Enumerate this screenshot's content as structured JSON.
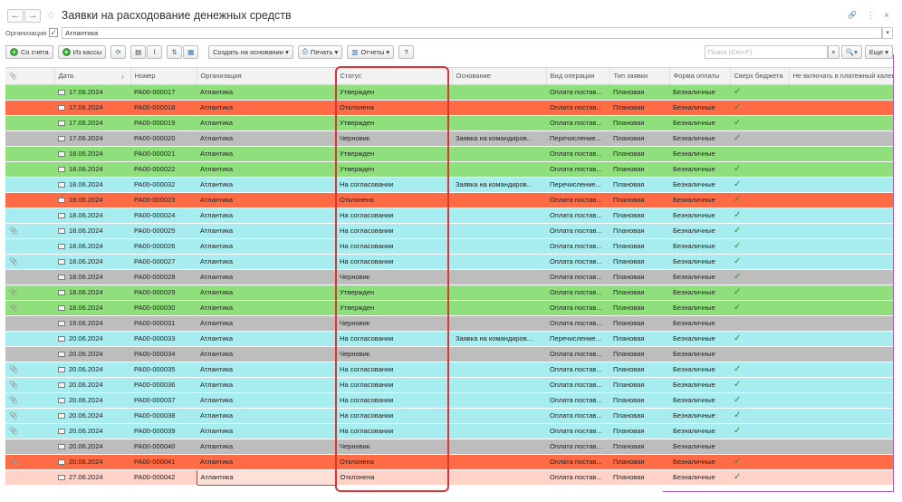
{
  "window": {
    "title": "Заявки на расходование денежных средств",
    "back_icon": "←",
    "forward_icon": "→",
    "star_icon": "☆",
    "link_icon": "🔗",
    "menu_icon": "⋮",
    "close_icon": "×"
  },
  "filter": {
    "label": "Организация",
    "checked_mark": "✓",
    "value": "Атлантика",
    "dropdown_icon": "▾"
  },
  "toolbar": {
    "from_account": "Со счета",
    "from_cash": "Из кассы",
    "create_based": "Создать на основании ▾",
    "print": "Печать ▾",
    "reports": "Отчеты ▾",
    "help": "?",
    "search_placeholder": "Поиск (Ctrl+F)",
    "search_clear": "×",
    "search_btn": "🔍▾",
    "more": "Еще ▾"
  },
  "columns": {
    "attach": "📎",
    "date": "Дата",
    "sort": "↓",
    "number": "Номер",
    "org": "Организация",
    "status": "Статус",
    "basis": "Основание",
    "op": "Вид операции",
    "type": "Тип заявки",
    "payform": "Форма оплаты",
    "over": "Сверх бюджета",
    "exclude": "Не включать в платежный календарь"
  },
  "rows": [
    {
      "c": "green",
      "clip": "",
      "date": "17.06.2024",
      "num": "РА00-000017",
      "org": "Атлантика",
      "status": "Утвержден",
      "basis": "",
      "op": "Оплата постав...",
      "type": "Плановая",
      "pay": "Безналичные",
      "over": "✓"
    },
    {
      "c": "red",
      "clip": "",
      "date": "17.06.2024",
      "num": "РА00-000018",
      "org": "Атлантика",
      "status": "Отклонена",
      "basis": "",
      "op": "Оплата постав...",
      "type": "Плановая",
      "pay": "Безналичные",
      "over": "✓"
    },
    {
      "c": "green",
      "clip": "",
      "date": "17.06.2024",
      "num": "РА00-000019",
      "org": "Атлантика",
      "status": "Утвержден",
      "basis": "",
      "op": "Оплата постав...",
      "type": "Плановая",
      "pay": "Безналичные",
      "over": "✓"
    },
    {
      "c": "gray",
      "clip": "",
      "date": "17.06.2024",
      "num": "РА00-000020",
      "org": "Атлантика",
      "status": "Черновик",
      "basis": "Заявка на командиров...",
      "op": "Перечисление...",
      "type": "Плановая",
      "pay": "Безналичные",
      "over": "✓"
    },
    {
      "c": "green",
      "clip": "",
      "date": "18.06.2024",
      "num": "РА00-000021",
      "org": "Атлантика",
      "status": "Утвержден",
      "basis": "",
      "op": "Оплата постав...",
      "type": "Плановая",
      "pay": "Безналичные",
      "over": ""
    },
    {
      "c": "green",
      "clip": "",
      "date": "18.06.2024",
      "num": "РА00-000022",
      "org": "Атлантика",
      "status": "Утвержден",
      "basis": "",
      "op": "Оплата постав...",
      "type": "Плановая",
      "pay": "Безналичные",
      "over": "✓"
    },
    {
      "c": "cyan",
      "clip": "",
      "date": "18.06.2024",
      "num": "РА00-000032",
      "org": "Атлантика",
      "status": "На согласовании",
      "basis": "Заявка на командиров...",
      "op": "Перечисление...",
      "type": "Плановая",
      "pay": "Безналичные",
      "over": "✓"
    },
    {
      "c": "red",
      "clip": "",
      "date": "18.06.2024",
      "num": "РА00-000023",
      "org": "Атлантика",
      "status": "Отклонена",
      "basis": "",
      "op": "Оплата постав...",
      "type": "Плановая",
      "pay": "Безналичные",
      "over": "✓"
    },
    {
      "c": "cyan",
      "clip": "",
      "date": "18.06.2024",
      "num": "РА00-000024",
      "org": "Атлантика",
      "status": "На согласовании",
      "basis": "",
      "op": "Оплата постав...",
      "type": "Плановая",
      "pay": "Безналичные",
      "over": "✓"
    },
    {
      "c": "cyan",
      "clip": "📎",
      "date": "18.06.2024",
      "num": "РА00-000025",
      "org": "Атлантика",
      "status": "На согласовании",
      "basis": "",
      "op": "Оплата постав...",
      "type": "Плановая",
      "pay": "Безналичные",
      "over": "✓"
    },
    {
      "c": "cyan",
      "clip": "",
      "date": "18.06.2024",
      "num": "РА00-000026",
      "org": "Атлантика",
      "status": "На согласовании",
      "basis": "",
      "op": "Оплата постав...",
      "type": "Плановая",
      "pay": "Безналичные",
      "over": "✓"
    },
    {
      "c": "cyan",
      "clip": "📎",
      "date": "18.06.2024",
      "num": "РА00-000027",
      "org": "Атлантика",
      "status": "На согласовании",
      "basis": "",
      "op": "Оплата постав...",
      "type": "Плановая",
      "pay": "Безналичные",
      "over": "✓"
    },
    {
      "c": "gray",
      "clip": "",
      "date": "18.06.2024",
      "num": "РА00-000028",
      "org": "Атлантика",
      "status": "Черновик",
      "basis": "",
      "op": "Оплата постав...",
      "type": "Плановая",
      "pay": "Безналичные",
      "over": "✓"
    },
    {
      "c": "green",
      "clip": "📎",
      "date": "18.06.2024",
      "num": "РА00-000029",
      "org": "Атлантика",
      "status": "Утвержден",
      "basis": "",
      "op": "Оплата постав...",
      "type": "Плановая",
      "pay": "Безналичные",
      "over": "✓"
    },
    {
      "c": "green",
      "clip": "📎",
      "date": "18.06.2024",
      "num": "РА00-000030",
      "org": "Атлантика",
      "status": "Утвержден",
      "basis": "",
      "op": "Оплата постав...",
      "type": "Плановая",
      "pay": "Безналичные",
      "over": "✓"
    },
    {
      "c": "gray",
      "clip": "",
      "date": "19.06.2024",
      "num": "РА00-000031",
      "org": "Атлантика",
      "status": "Черновик",
      "basis": "",
      "op": "Оплата постав...",
      "type": "Плановая",
      "pay": "Безналичные",
      "over": ""
    },
    {
      "c": "cyan",
      "clip": "",
      "date": "20.06.2024",
      "num": "РА00-000033",
      "org": "Атлантика",
      "status": "На согласовании",
      "basis": "Заявка на командиров...",
      "op": "Перечисление...",
      "type": "Плановая",
      "pay": "Безналичные",
      "over": "✓"
    },
    {
      "c": "gray",
      "clip": "",
      "date": "20.06.2024",
      "num": "РА00-000034",
      "org": "Атлантика",
      "status": "Черновик",
      "basis": "",
      "op": "Оплата постав...",
      "type": "Плановая",
      "pay": "Безналичные",
      "over": ""
    },
    {
      "c": "cyan",
      "clip": "📎",
      "date": "20.06.2024",
      "num": "РА00-000035",
      "org": "Атлантика",
      "status": "На согласовании",
      "basis": "",
      "op": "Оплата постав...",
      "type": "Плановая",
      "pay": "Безналичные",
      "over": "✓"
    },
    {
      "c": "cyan",
      "clip": "📎",
      "date": "20.06.2024",
      "num": "РА00-000036",
      "org": "Атлантика",
      "status": "На согласовании",
      "basis": "",
      "op": "Оплата постав...",
      "type": "Плановая",
      "pay": "Безналичные",
      "over": "✓"
    },
    {
      "c": "cyan",
      "clip": "📎",
      "date": "20.06.2024",
      "num": "РА00-000037",
      "org": "Атлантика",
      "status": "На согласовании",
      "basis": "",
      "op": "Оплата постав...",
      "type": "Плановая",
      "pay": "Безналичные",
      "over": "✓"
    },
    {
      "c": "cyan",
      "clip": "📎",
      "date": "20.06.2024",
      "num": "РА00-000038",
      "org": "Атлантика",
      "status": "На согласовании",
      "basis": "",
      "op": "Оплата постав...",
      "type": "Плановая",
      "pay": "Безналичные",
      "over": "✓"
    },
    {
      "c": "cyan",
      "clip": "📎",
      "date": "20.06.2024",
      "num": "РА00-000039",
      "org": "Атлантика",
      "status": "На согласовании",
      "basis": "",
      "op": "Оплата постав...",
      "type": "Плановая",
      "pay": "Безналичные",
      "over": "✓"
    },
    {
      "c": "gray",
      "clip": "",
      "date": "20.06.2024",
      "num": "РА00-000040",
      "org": "Атлантика",
      "status": "Черновик",
      "basis": "",
      "op": "Оплата постав...",
      "type": "Плановая",
      "pay": "Безналичные",
      "over": ""
    },
    {
      "c": "red",
      "clip": "📎",
      "date": "20.06.2024",
      "num": "РА00-000041",
      "org": "Атлантика",
      "status": "Отклонена",
      "basis": "",
      "op": "Оплата постав...",
      "type": "Плановая",
      "pay": "Безналичные",
      "over": "✓"
    },
    {
      "c": "pink",
      "clip": "",
      "date": "27.06.2024",
      "num": "РА00-000042",
      "org": "Атлантика",
      "status": "Отклонена",
      "basis": "",
      "op": "Оплата постав...",
      "type": "Плановая",
      "pay": "Безналичные",
      "over": "✓"
    }
  ]
}
